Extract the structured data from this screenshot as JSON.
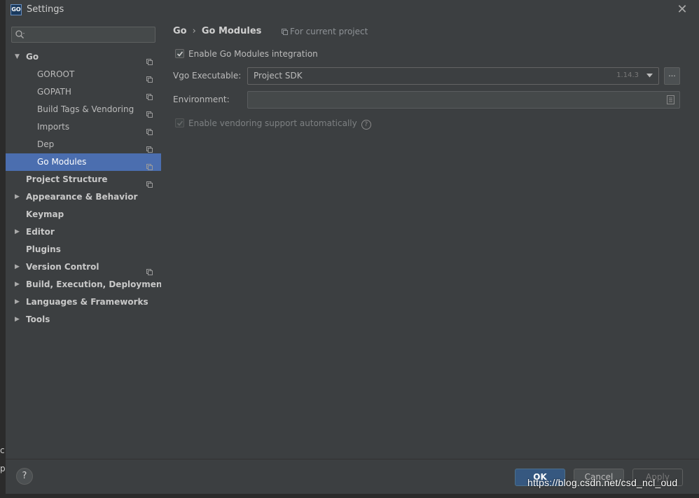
{
  "window": {
    "title": "Settings",
    "app_icon_text": "GO"
  },
  "host_fragments": [
    "c",
    "p"
  ],
  "sidebar": {
    "search_placeholder": "",
    "items": [
      {
        "label": "Go",
        "level": 0,
        "bold": true,
        "arrow": "expanded",
        "scope": true
      },
      {
        "label": "GOROOT",
        "level": 1,
        "bold": false,
        "arrow": "none",
        "scope": true
      },
      {
        "label": "GOPATH",
        "level": 1,
        "bold": false,
        "arrow": "none",
        "scope": true
      },
      {
        "label": "Build Tags & Vendoring",
        "level": 1,
        "bold": false,
        "arrow": "none",
        "scope": true
      },
      {
        "label": "Imports",
        "level": 1,
        "bold": false,
        "arrow": "none",
        "scope": true
      },
      {
        "label": "Dep",
        "level": 1,
        "bold": false,
        "arrow": "none",
        "scope": true
      },
      {
        "label": "Go Modules",
        "level": 1,
        "bold": false,
        "arrow": "none",
        "scope": true,
        "selected": true
      },
      {
        "label": "Project Structure",
        "level": 0,
        "bold": true,
        "arrow": "none",
        "scope": true
      },
      {
        "label": "Appearance & Behavior",
        "level": 0,
        "bold": true,
        "arrow": "collapsed",
        "scope": false
      },
      {
        "label": "Keymap",
        "level": 0,
        "bold": true,
        "arrow": "none",
        "scope": false
      },
      {
        "label": "Editor",
        "level": 0,
        "bold": true,
        "arrow": "collapsed",
        "scope": false
      },
      {
        "label": "Plugins",
        "level": 0,
        "bold": true,
        "arrow": "none",
        "scope": false
      },
      {
        "label": "Version Control",
        "level": 0,
        "bold": true,
        "arrow": "collapsed",
        "scope": true
      },
      {
        "label": "Build, Execution, Deployment",
        "level": 0,
        "bold": true,
        "arrow": "collapsed",
        "scope": false
      },
      {
        "label": "Languages & Frameworks",
        "level": 0,
        "bold": true,
        "arrow": "collapsed",
        "scope": false
      },
      {
        "label": "Tools",
        "level": 0,
        "bold": true,
        "arrow": "collapsed",
        "scope": false
      }
    ]
  },
  "content": {
    "breadcrumb": [
      "Go",
      "Go Modules"
    ],
    "breadcrumb_sep": "›",
    "scope_note": "For current project",
    "enable_modules": {
      "label": "Enable Go Modules integration",
      "checked": true
    },
    "vgo_executable": {
      "label": "Vgo Executable:",
      "value": "Project SDK",
      "version": "1.14.3",
      "browse_label": "..."
    },
    "environment": {
      "label": "Environment:",
      "value": ""
    },
    "vendoring": {
      "label": "Enable vendoring support automatically",
      "checked": true,
      "disabled": true
    }
  },
  "footer": {
    "help_label": "?",
    "ok_label": "OK",
    "cancel_label": "Cancel",
    "apply_label": "Apply"
  },
  "watermark": "https://blog.csdn.net/csd_ncl_oud",
  "colors": {
    "selection": "#4b6eaf",
    "ok_button": "#365880",
    "background": "#3c3f41"
  }
}
